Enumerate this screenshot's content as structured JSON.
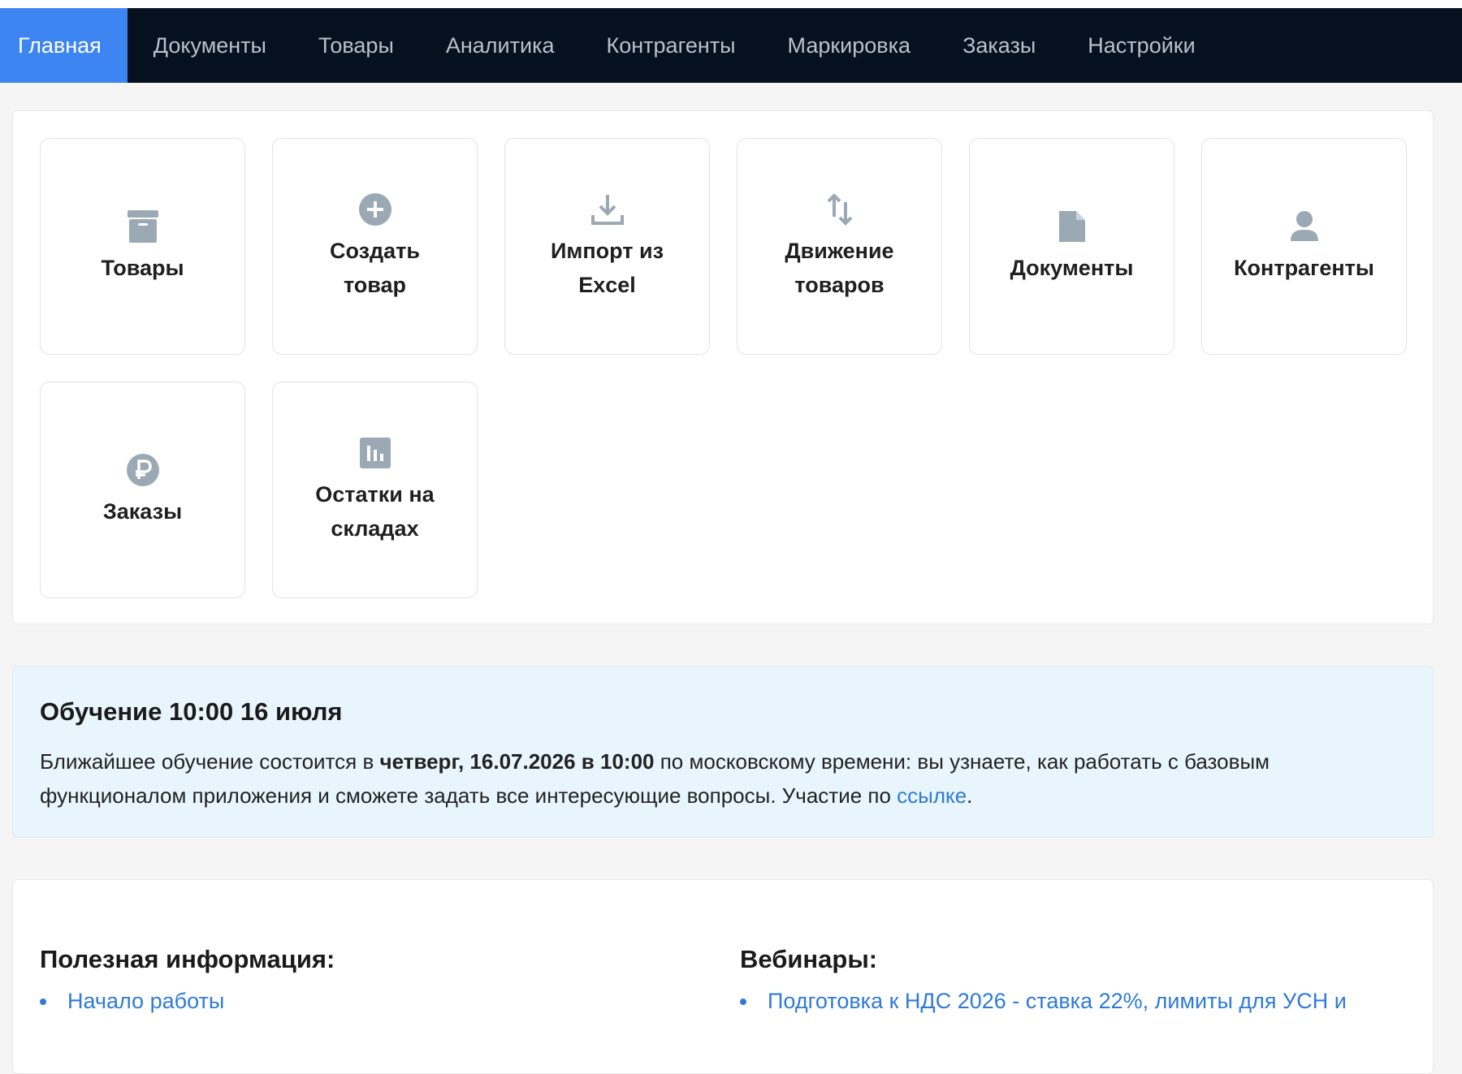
{
  "nav": {
    "items": [
      {
        "label": "Главная",
        "active": true
      },
      {
        "label": "Документы"
      },
      {
        "label": "Товары"
      },
      {
        "label": "Аналитика"
      },
      {
        "label": "Контрагенты"
      },
      {
        "label": "Маркировка"
      },
      {
        "label": "Заказы"
      },
      {
        "label": "Настройки"
      }
    ]
  },
  "tiles": [
    {
      "label": "Товары",
      "icon": "archive-icon"
    },
    {
      "label": "Создать товар",
      "icon": "plus-circle-icon"
    },
    {
      "label": "Импорт из Excel",
      "icon": "download-icon"
    },
    {
      "label": "Движение товаров",
      "icon": "arrows-up-down-icon"
    },
    {
      "label": "Документы",
      "icon": "file-icon"
    },
    {
      "label": "Контрагенты",
      "icon": "user-icon"
    },
    {
      "label": "Заказы",
      "icon": "ruble-icon"
    },
    {
      "label": "Остатки на складах",
      "icon": "chart-bar-icon"
    }
  ],
  "notice": {
    "title": "Обучение 10:00 16 июля",
    "text_before": "Ближайшее обучение состоится в ",
    "text_bold": "четверг, 16.07.2026 в 10:00",
    "text_after": " по московскому времени: вы узнаете, как работать с базовым функционалом приложения и сможете задать все интересующие вопросы. Участие по ",
    "link_label": "ссылке",
    "text_end": "."
  },
  "info": {
    "useful_title": "Полезная информация:",
    "useful_items": [
      "Начало работы"
    ],
    "webinars_title": "Вебинары:",
    "webinar_items": [
      "Подготовка к НДС 2026 - ставка 22%, лимиты для УСН и"
    ]
  },
  "colors": {
    "nav_bg": "#06111f",
    "nav_active": "#3d86f2",
    "icon_gray": "#9aa9b3",
    "link": "#2f7ad8",
    "notice_bg": "#e8f5fd"
  }
}
